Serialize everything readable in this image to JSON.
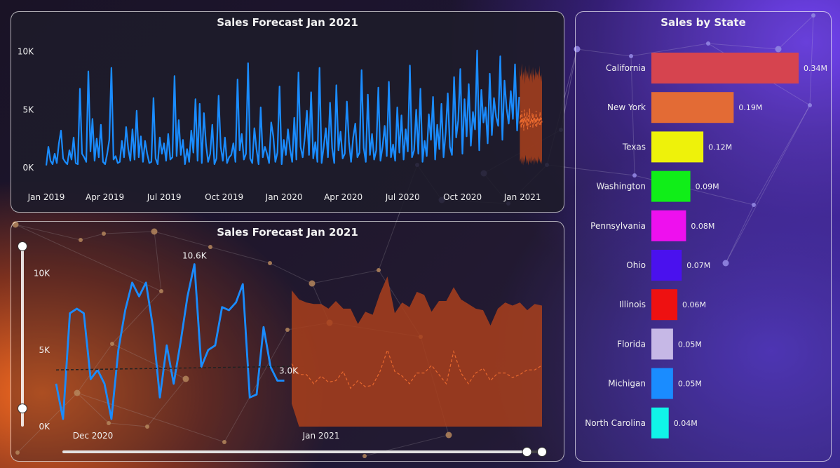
{
  "colors": {
    "actual_line": "#1a8cff",
    "forecast_band": "#a9401c",
    "forecast_line": "#e8682e",
    "trend_line": "#222222",
    "axis_text": "#f0f0f0"
  },
  "chart_data": [
    {
      "type": "line",
      "title": "Sales Forecast Jan 2021",
      "xlabel": "",
      "ylabel": "",
      "x_tick_labels": [
        "Jan 2019",
        "Apr 2019",
        "Jul 2019",
        "Oct 2019",
        "Jan 2020",
        "Apr 2020",
        "Jul 2020",
        "Oct 2020",
        "Jan 2021"
      ],
      "y_tick_labels": [
        "0K",
        "5K",
        "10K"
      ],
      "y_ticks": [
        0,
        5000,
        10000
      ],
      "ylim": [
        0,
        11000
      ],
      "x_range": [
        "2019-01-01",
        "2021-01-31"
      ],
      "grid": false,
      "series": [
        {
          "role": "actual",
          "x_range": [
            "2019-01-01",
            "2020-12-27"
          ],
          "values": [
            200,
            1800,
            600,
            300,
            1200,
            400,
            2100,
            3200,
            800,
            500,
            300,
            1500,
            700,
            2600,
            400,
            300,
            6800,
            1200,
            900,
            500,
            8300,
            1400,
            4200,
            600,
            2500,
            900,
            3700,
            500,
            300,
            1200,
            2400,
            8600,
            700,
            1000,
            400,
            500,
            2300,
            900,
            3500,
            1600,
            600,
            3300,
            700,
            4900,
            900,
            2700,
            500,
            2300,
            1200,
            400,
            500,
            6000,
            800,
            300,
            2600,
            1200,
            2100,
            600,
            2900,
            700,
            900,
            7900,
            1000,
            4100,
            1100,
            2400,
            300,
            1600,
            500,
            3200,
            1300,
            5900,
            600,
            5500,
            400,
            4700,
            2000,
            500,
            1200,
            3700,
            300,
            800,
            6200,
            1800,
            600,
            2600,
            400,
            900,
            1100,
            2100,
            500,
            7600,
            1500,
            2900,
            700,
            1200,
            9000,
            800,
            400,
            3400,
            1600,
            300,
            5200,
            900,
            1800,
            1200,
            400,
            3900,
            2700,
            500,
            1300,
            7000,
            300,
            2400,
            1100,
            3300,
            1600,
            500,
            4300,
            700,
            8200,
            1800,
            900,
            2600,
            4900,
            1100,
            6500,
            800,
            2200,
            500,
            8600,
            400,
            1800,
            3400,
            900,
            5600,
            1700,
            400,
            7100,
            1500,
            3100,
            800,
            1200,
            5700,
            2200,
            500,
            2600,
            3800,
            900,
            1300,
            8400,
            1700,
            500,
            6300,
            1100,
            2900,
            700,
            1500,
            6900,
            600,
            1800,
            3600,
            1000,
            7400,
            900,
            2000,
            600,
            5200,
            1300,
            4500,
            700,
            3300,
            1400,
            8800,
            900,
            1500,
            5000,
            1200,
            6800,
            500,
            2300,
            1000,
            4600,
            2400,
            6100,
            700,
            3700,
            1600,
            5500,
            900,
            3000,
            6400,
            1800,
            1100,
            7800,
            2600,
            4100,
            8500,
            1200,
            5900,
            2700,
            7200,
            1900,
            4800,
            3300,
            10100,
            1500,
            6700,
            3900,
            5200,
            2100,
            8100,
            2800,
            6000,
            4400,
            3600,
            9600,
            2400,
            7500,
            5100,
            3800,
            6600,
            4200,
            8900,
            3200,
            6100
          ]
        },
        {
          "role": "forecast",
          "x_range": [
            "2020-12-28",
            "2021-01-31"
          ],
          "upper": [
            8700,
            7800,
            8100,
            9000,
            7500,
            8300,
            7900,
            8600,
            7200,
            8800,
            7700,
            8400,
            8000,
            7600,
            8900,
            7400,
            8200,
            7800,
            8500,
            7300,
            8700,
            7900,
            8100,
            7500,
            8600,
            7700,
            8300,
            7900,
            8400,
            7600,
            8800,
            7800,
            8000,
            7400,
            8200
          ],
          "center": [
            3800,
            4600,
            3400,
            4900,
            3700,
            4300,
            3200,
            5000,
            3900,
            4400,
            3600,
            4800,
            3300,
            4500,
            3700,
            5100,
            3500,
            4200,
            3900,
            4700,
            3400,
            4600,
            3800,
            4300,
            3600,
            4900,
            3500,
            4400,
            3800,
            4200,
            3700,
            4800,
            3600,
            4300,
            3900
          ],
          "lower": [
            500,
            800,
            300,
            1000,
            600,
            200,
            900,
            400,
            700,
            1100,
            300,
            800,
            500,
            200,
            900,
            600,
            400,
            1000,
            300,
            700,
            500,
            800,
            200,
            900,
            600,
            400,
            700,
            300,
            1000,
            500,
            800,
            400,
            600,
            300,
            700
          ]
        }
      ]
    },
    {
      "type": "line",
      "title": "Sales Forecast Jan 2021",
      "xlabel": "",
      "ylabel": "",
      "x_tick_labels": [
        "Dec 2020",
        "Jan 2021"
      ],
      "y_tick_labels": [
        "0K",
        "5K",
        "10K"
      ],
      "y_ticks": [
        0,
        5000,
        10000
      ],
      "ylim": [
        0,
        12000
      ],
      "data_labels": [
        "10.6K",
        "3.0K"
      ],
      "grid": false,
      "series": [
        {
          "role": "actual",
          "x_range": [
            "2020-11-26",
            "2020-12-27"
          ],
          "values": [
            2800,
            500,
            7400,
            7700,
            7400,
            3100,
            3700,
            2800,
            500,
            5000,
            7600,
            9400,
            8500,
            9400,
            6500,
            1900,
            5300,
            2800,
            5500,
            8500,
            10600,
            3900,
            5000,
            5300,
            7800,
            7600,
            8100,
            9300,
            1900,
            2100,
            6500,
            3900,
            3000,
            3000
          ]
        },
        {
          "role": "trend",
          "x_range": [
            "2020-11-26",
            "2020-12-31"
          ],
          "values": [
            3700,
            3950
          ]
        },
        {
          "role": "forecast",
          "x_range": [
            "2020-12-28",
            "2021-01-31"
          ],
          "upper": [
            8900,
            8300,
            8100,
            8000,
            8000,
            7700,
            8200,
            7700,
            7700,
            6700,
            7500,
            7300,
            8700,
            9800,
            7400,
            8100,
            7800,
            8800,
            8600,
            7500,
            8200,
            8200,
            9100,
            8300,
            8000,
            7700,
            7600,
            6600,
            7700,
            8100,
            7900,
            8100,
            7600,
            8000,
            7900
          ],
          "center": [
            4100,
            3400,
            3400,
            2800,
            3300,
            2900,
            3000,
            3600,
            2500,
            3000,
            2600,
            2700,
            3600,
            5000,
            3600,
            3300,
            2800,
            3500,
            3500,
            4000,
            3400,
            2800,
            4900,
            3500,
            2800,
            3500,
            3800,
            3000,
            3500,
            3500,
            3200,
            3400,
            3700,
            3700,
            4000
          ],
          "lower": [
            1500,
            0,
            0,
            0,
            0,
            0,
            0,
            0,
            0,
            0,
            0,
            0,
            0,
            0,
            0,
            0,
            0,
            0,
            0,
            0,
            0,
            0,
            0,
            0,
            0,
            0,
            0,
            0,
            0,
            0,
            0,
            0,
            0,
            0,
            0
          ]
        }
      ]
    },
    {
      "type": "bar",
      "orientation": "horizontal",
      "title": "Sales by State",
      "xlabel": "",
      "ylabel": "",
      "categories": [
        "California",
        "New York",
        "Texas",
        "Washington",
        "Pennsylvania",
        "Ohio",
        "Illinois",
        "Florida",
        "Michigan",
        "North Carolina"
      ],
      "values": [
        0.34,
        0.19,
        0.12,
        0.09,
        0.08,
        0.07,
        0.06,
        0.05,
        0.05,
        0.04
      ],
      "value_labels": [
        "0.34M",
        "0.19M",
        "0.12M",
        "0.09M",
        "0.08M",
        "0.07M",
        "0.06M",
        "0.05M",
        "0.05M",
        "0.04M"
      ],
      "units": "M",
      "bar_colors": [
        "#d6444f",
        "#e36b35",
        "#eef20a",
        "#10ee18",
        "#ee10ee",
        "#4a11ee",
        "#ee1111",
        "#c6b8e6",
        "#1a8cff",
        "#10f4e8"
      ]
    }
  ],
  "slicer": {
    "vertical_position": [
      0,
      1
    ],
    "horizontal_position": [
      0.97,
      1
    ]
  }
}
